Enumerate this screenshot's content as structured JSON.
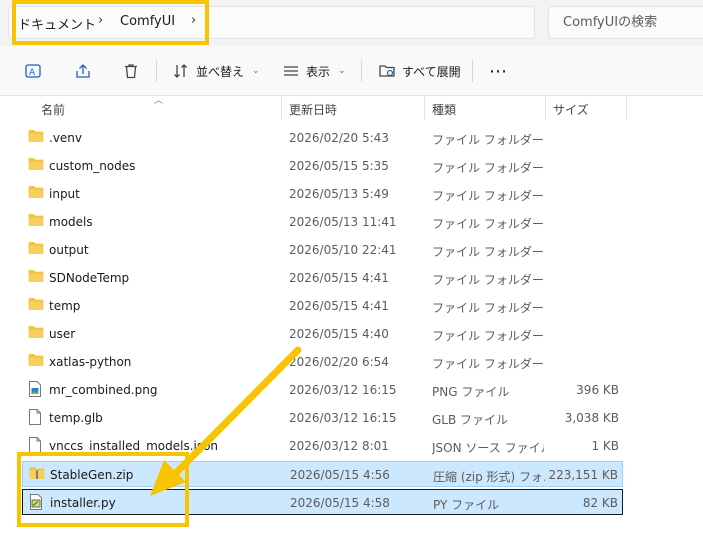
{
  "address_bar": {
    "crumbs": [
      "ドキュメント",
      "ComfyUI"
    ]
  },
  "search": {
    "placeholder": "ComfyUIの検索"
  },
  "toolbar": {
    "sort_label": "並べ替え",
    "view_label": "表示",
    "expand_all_label": "すべて展開"
  },
  "columns": {
    "name": "名前",
    "date": "更新日時",
    "type": "種類",
    "size": "サイズ"
  },
  "files": [
    {
      "name": ".venv",
      "date": "2026/02/20 5:43",
      "type": "ファイル フォルダー",
      "size": "",
      "icon": "folder-icon"
    },
    {
      "name": "custom_nodes",
      "date": "2026/05/15 5:35",
      "type": "ファイル フォルダー",
      "size": "",
      "icon": "folder-icon"
    },
    {
      "name": "input",
      "date": "2026/05/13 5:49",
      "type": "ファイル フォルダー",
      "size": "",
      "icon": "folder-icon"
    },
    {
      "name": "models",
      "date": "2026/05/13 11:41",
      "type": "ファイル フォルダー",
      "size": "",
      "icon": "folder-icon"
    },
    {
      "name": "output",
      "date": "2026/05/10 22:41",
      "type": "ファイル フォルダー",
      "size": "",
      "icon": "folder-icon"
    },
    {
      "name": "SDNodeTemp",
      "date": "2026/05/15 4:41",
      "type": "ファイル フォルダー",
      "size": "",
      "icon": "folder-icon"
    },
    {
      "name": "temp",
      "date": "2026/05/15 4:41",
      "type": "ファイル フォルダー",
      "size": "",
      "icon": "folder-icon"
    },
    {
      "name": "user",
      "date": "2026/05/15 4:40",
      "type": "ファイル フォルダー",
      "size": "",
      "icon": "folder-icon"
    },
    {
      "name": "xatlas-python",
      "date": "2026/02/20 6:54",
      "type": "ファイル フォルダー",
      "size": "",
      "icon": "folder-icon"
    },
    {
      "name": "mr_combined.png",
      "date": "2026/03/12 16:15",
      "type": "PNG ファイル",
      "size": "396 KB",
      "icon": "image-file-icon"
    },
    {
      "name": "temp.glb",
      "date": "2026/03/12 16:15",
      "type": "GLB ファイル",
      "size": "3,038 KB",
      "icon": "file-icon"
    },
    {
      "name": "vnccs_installed_models.json",
      "date": "2026/03/12 8:01",
      "type": "JSON ソース ファイル",
      "size": "1 KB",
      "icon": "file-icon"
    },
    {
      "name": "StableGen.zip",
      "date": "2026/05/15 4:56",
      "type": "圧縮 (zip 形式) フォ...",
      "size": "223,151 KB",
      "icon": "zip-folder-icon",
      "selected": true
    },
    {
      "name": "installer.py",
      "date": "2026/05/15 4:58",
      "type": "PY ファイル",
      "size": "82 KB",
      "icon": "python-file-icon",
      "selected": true,
      "focused": true
    }
  ],
  "colors": {
    "highlight": "#f8c300",
    "selection_bg": "#cce8ff",
    "folder": "#f3c24c"
  }
}
